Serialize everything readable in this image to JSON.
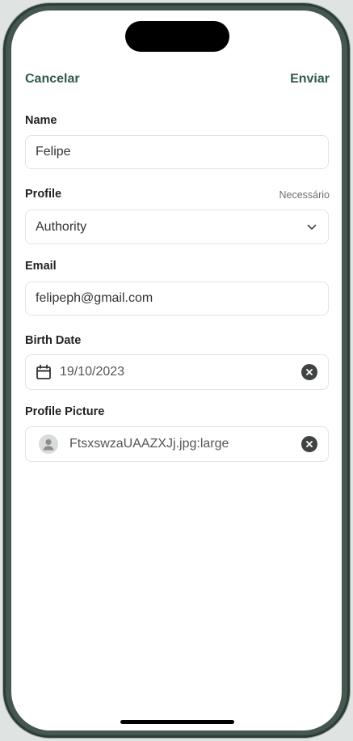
{
  "header": {
    "cancel_label": "Cancelar",
    "submit_label": "Enviar",
    "accent_color": "#2f5a47"
  },
  "form": {
    "name": {
      "label": "Name",
      "value": "Felipe"
    },
    "profile": {
      "label": "Profile",
      "required_text": "Necessário",
      "selected": "Authority",
      "icon": "chevron-down-icon"
    },
    "email": {
      "label": "Email",
      "value": "felipeph@gmail.com"
    },
    "birth_date": {
      "label": "Birth Date",
      "value": "19/10/2023",
      "icon": "calendar-icon",
      "clear_icon": "clear-circle-icon"
    },
    "profile_picture": {
      "label": "Profile Picture",
      "file_name": "FtsxswzaUAAZXJj.jpg:large",
      "icon": "user-avatar-icon",
      "clear_icon": "clear-circle-icon"
    }
  }
}
